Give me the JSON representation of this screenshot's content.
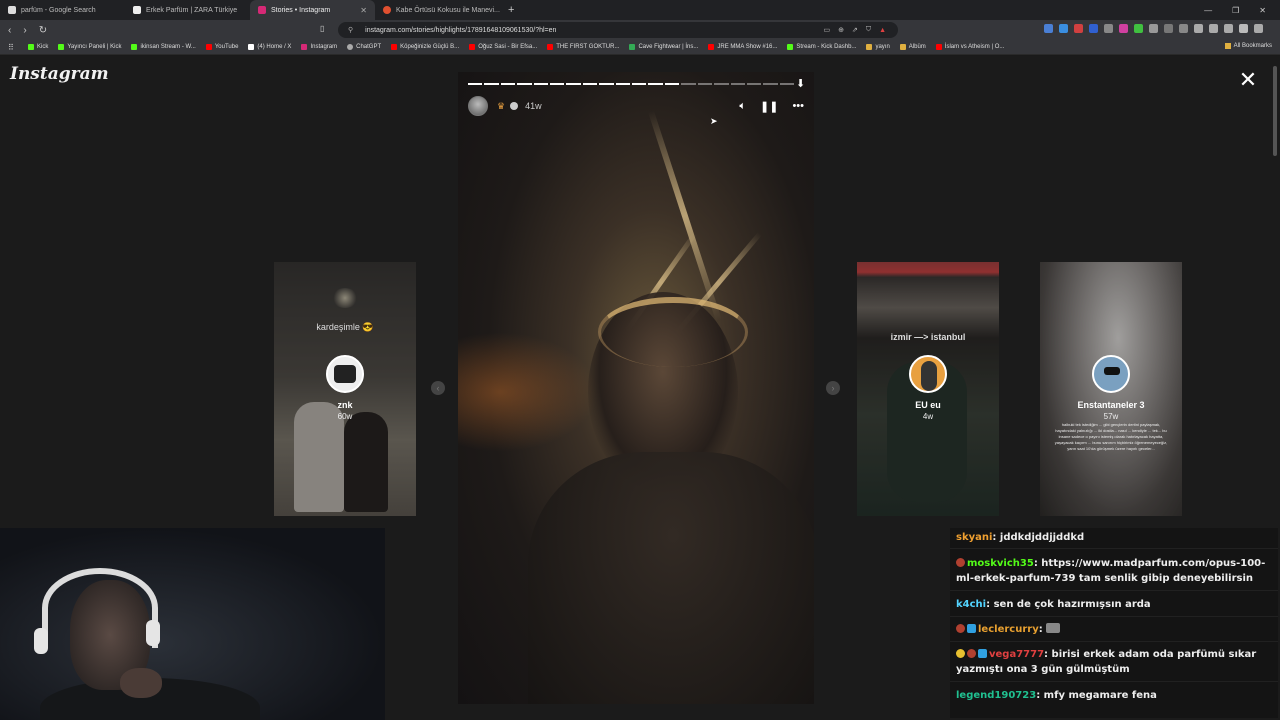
{
  "browser": {
    "tabs": [
      {
        "label": "parfüm - Google Search",
        "color": "#dddddd"
      },
      {
        "label": "Erkek Parfüm | ZARA Türkiye",
        "color": "#eeeeee"
      },
      {
        "label": "Stories • Instagram",
        "color": "#d62976"
      },
      {
        "label": "Kabe Örtüsü Kokusu ile Manevi...",
        "color": "#e05030"
      }
    ],
    "new_tab": "+",
    "url": "instagram.com/stories/highlights/17891648109061530/?hl=en",
    "bookmarks": [
      {
        "label": "Kick",
        "color": "#53fc18"
      },
      {
        "label": "Yayıncı Paneli | Kick",
        "color": "#53fc18"
      },
      {
        "label": "ikinsan Stream - W...",
        "color": "#53fc18"
      },
      {
        "label": "YouTube",
        "color": "#ff0000"
      },
      {
        "label": "(4) Home / X",
        "color": "#ffffff"
      },
      {
        "label": "Instagram",
        "color": "#d62976"
      },
      {
        "label": "ChatGPT",
        "color": "#aaaaaa"
      },
      {
        "label": "Köpeğinizle Güçlü B...",
        "color": "#ff0000"
      },
      {
        "label": "Oğuz Sasi - Bir Efsa...",
        "color": "#ff0000"
      },
      {
        "label": "THE FIRST GOKTUR...",
        "color": "#ff0000"
      },
      {
        "label": "Cave Fightwear | İns...",
        "color": "#33aa55"
      },
      {
        "label": "JRE MMA Show #16...",
        "color": "#ff0000"
      },
      {
        "label": "Stream - Kick Dashb...",
        "color": "#53fc18"
      },
      {
        "label": "yayın",
        "color": "#e0b040"
      },
      {
        "label": "Albüm",
        "color": "#e0b040"
      },
      {
        "label": "İslam vs Atheism | O...",
        "color": "#ff0000"
      }
    ],
    "all_bookmarks": "All Bookmarks"
  },
  "instagram": {
    "logo": "Instagram",
    "story": {
      "age": "41w",
      "segments_total": 20,
      "segments_done": 13
    },
    "side_cards": [
      {
        "caption": "kardeşimle 😎",
        "name": "znk",
        "age": "60w"
      },
      {
        "caption": "izmir —> istanbul",
        "name": "EU eu",
        "age": "4w"
      },
      {
        "caption": "",
        "name": "Enstantaneler 3",
        "age": "57w",
        "small_text": "halbuki tek istediğim ... gibi gençlerin dertini paylaşmak, hayatındaki yalnızlığı ... iki dostla... nasıl ... kendiyle ... tek... bu insane sadece o payını istemiş olarak hatırlayacak hayatta, yaşayacak kaçırm ... bunu sanırım hiçbirimiz öğrenemeyeceğiz, yarın saat 10'da görüşmek üzere hayırlı geceler..."
      }
    ]
  },
  "chat": {
    "messages": [
      {
        "user": "skyani",
        "user_color": "#f0a030",
        "text": "jddkdjddjjddkd"
      },
      {
        "user": "moskvich35",
        "user_color": "#53fc18",
        "text": "https://www.madparfum.com/opus-100-ml-erkek-parfum-739 tam senlik gibip deneyebilirsin"
      },
      {
        "user": "k4chi",
        "user_color": "#53d4ff",
        "text": "sen de çok hazırmışsın arda"
      },
      {
        "user": "leclercurry",
        "user_color": "#e8a030",
        "text": ""
      },
      {
        "user": "vega7777",
        "user_color": "#e04040",
        "text": "birisi erkek adam oda parfümü sıkar yazmıştı ona 3 gün gülmüştüm"
      },
      {
        "user": "legend190723",
        "user_color": "#20c090",
        "text": "mfy megamare fena"
      }
    ]
  }
}
